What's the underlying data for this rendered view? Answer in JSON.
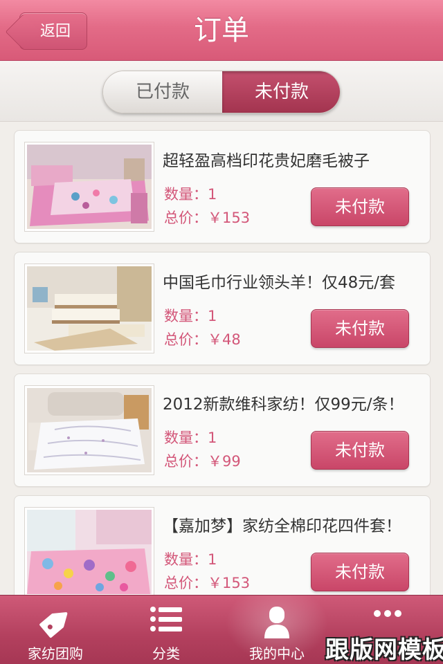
{
  "header": {
    "back_label": "返回",
    "title": "订单"
  },
  "tabs": {
    "paid_label": "已付款",
    "unpaid_label": "未付款",
    "active": "unpaid"
  },
  "orders": [
    {
      "title": "超轻盈高档印花贵妃磨毛被子",
      "quantity": "数量：1",
      "total": "总价：￥153",
      "button": "未付款",
      "image": "pink-bedding-photo"
    },
    {
      "title": "中国毛巾行业领头羊！仅48元/套",
      "quantity": "数量：1",
      "total": "总价：￥48",
      "button": "未付款",
      "image": "towel-set-photo"
    },
    {
      "title": "2012新款维科家纺！仅99元/条！",
      "quantity": "数量：1",
      "total": "总价：￥99",
      "button": "未付款",
      "image": "white-quilt-photo"
    },
    {
      "title": "【嘉加梦】家纺全棉印花四件套！",
      "quantity": "数量：1",
      "total": "总价：￥153",
      "button": "未付款",
      "image": "floral-bedding-photo"
    }
  ],
  "tabbar": {
    "items": [
      {
        "label": "家纺团购",
        "icon": "tag-icon"
      },
      {
        "label": "分类",
        "icon": "list-icon"
      },
      {
        "label": "我的中心",
        "icon": "user-icon"
      },
      {
        "label": "",
        "icon": "more-icon"
      }
    ],
    "active_index": 2
  },
  "watermark": "跟版网模板",
  "colors": {
    "accent": "#d85a78",
    "price_text": "#d35779",
    "background": "#f1eeea"
  }
}
